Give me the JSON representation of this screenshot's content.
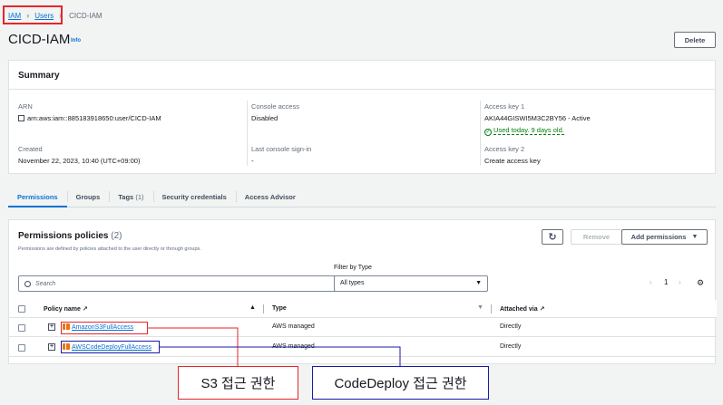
{
  "breadcrumb": {
    "iam": "IAM",
    "users": "Users",
    "current": "CICD-IAM"
  },
  "header": {
    "title": "CICD-IAM",
    "info": "Info",
    "delete": "Delete"
  },
  "summary": {
    "title": "Summary",
    "arn_label": "ARN",
    "arn_value": "arn:aws:iam::885183918650:user/CICD-IAM",
    "console_label": "Console access",
    "console_value": "Disabled",
    "key1_label": "Access key 1",
    "key1_value": "AKIA44GISWI5M3C2BY56 - Active",
    "key1_status": "Used today. 9 days old.",
    "created_label": "Created",
    "created_value": "November 22, 2023, 10:40 (UTC+09:00)",
    "signin_label": "Last console sign-in",
    "signin_value": "-",
    "key2_label": "Access key 2",
    "key2_link": "Create access key"
  },
  "tabs": [
    {
      "label": "Permissions",
      "count": ""
    },
    {
      "label": "Groups",
      "count": ""
    },
    {
      "label": "Tags",
      "count": "(1)"
    },
    {
      "label": "Security credentials",
      "count": ""
    },
    {
      "label": "Access Advisor",
      "count": ""
    }
  ],
  "permissions": {
    "title": "Permissions policies",
    "count": "(2)",
    "desc": "Permissions are defined by policies attached to the user directly or through groups.",
    "refresh": "↻",
    "remove": "Remove",
    "add": "Add permissions",
    "search_placeholder": "Search",
    "filter_label": "Filter by Type",
    "filter_value": "All types",
    "page": "1",
    "columns": {
      "name": "Policy name",
      "type": "Type",
      "attached": "Attached via"
    },
    "rows": [
      {
        "name": "AmazonS3FullAccess",
        "type": "AWS managed",
        "attached": "Directly"
      },
      {
        "name": "AWSCodeDeployFullAccess",
        "type": "AWS managed",
        "attached": "Directly"
      }
    ]
  },
  "annotations": {
    "s3": "S3 접근 권한",
    "codedeploy": "CodeDeploy 접근 권한"
  },
  "colors": {
    "red": "#e5262a",
    "blue": "#1a1aa6",
    "link": "#0972d3"
  }
}
